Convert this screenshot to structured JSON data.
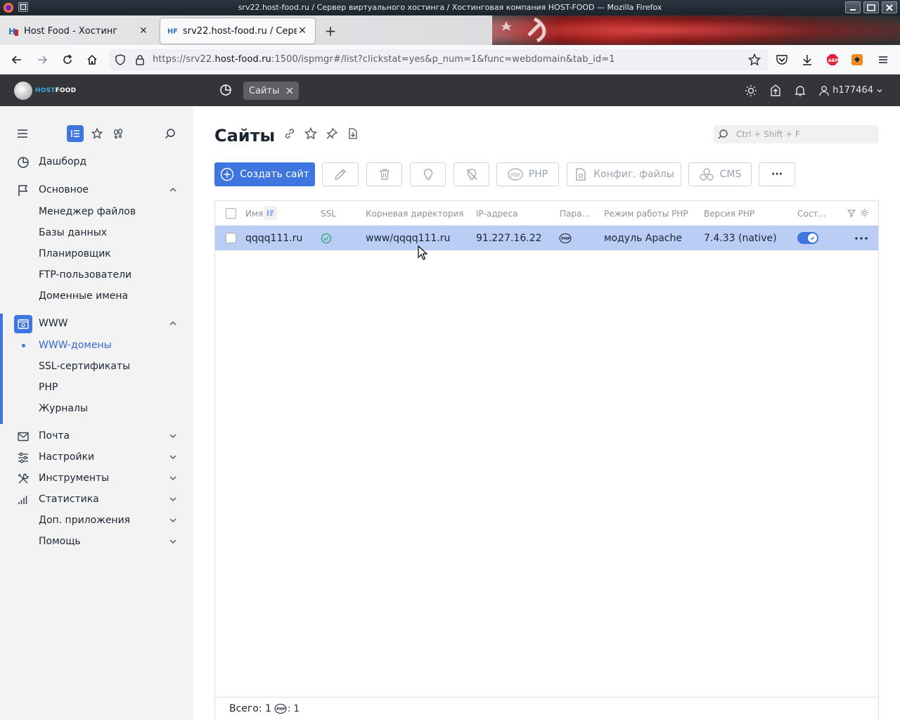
{
  "window": {
    "title": "srv22.host-food.ru / Сервер виртуального хостинга / Хостинговая компания HOST-FOOD — Mozilla Firefox"
  },
  "browser": {
    "tabs": [
      {
        "label": "Host Food - Хостинг",
        "favicon": "hf-red-icon"
      },
      {
        "label": "srv22.host-food.ru / Сервер",
        "favicon": "hf-blue-icon"
      }
    ],
    "url_prefix": "https://srv22.",
    "url_host": "host-food.ru",
    "url_suffix": ":1500/ispmgr#/list?clickstat=yes&p_num=1&func=webdomain&tab_id=1"
  },
  "header": {
    "logo_host": "HOST",
    "logo_food": "FOOD",
    "chip_label": "Сайты",
    "username": "h177464"
  },
  "sidebar": {
    "dashboard": "Дашборд",
    "main": "Основное",
    "main_items": [
      "Менеджер файлов",
      "Базы данных",
      "Планировщик",
      "FTP-пользователи",
      "Доменные имена"
    ],
    "www": "WWW",
    "www_items": [
      "WWW-домены",
      "SSL-сертификаты",
      "PHP",
      "Журналы"
    ],
    "mail": "Почта",
    "settings": "Настройки",
    "tools": "Инструменты",
    "stats": "Статистика",
    "extra_apps": "Доп. приложения",
    "help": "Помощь"
  },
  "page": {
    "title": "Сайты",
    "search_placeholder": "Ctrl + Shift + F"
  },
  "toolbar": {
    "create_site": "Создать сайт",
    "php": "PHP",
    "config_files": "Конфиг. файлы",
    "cms": "CMS",
    "more": "···"
  },
  "table": {
    "columns": [
      "Имя",
      "SSL",
      "Корневая директория",
      "IP-адреса",
      "Пара...",
      "Режим работы PHP",
      "Версия PHP",
      "Сост..."
    ],
    "rows": [
      {
        "name": "qqqq111.ru",
        "ssl": "check-icon",
        "root_dir": "www/qqqq111.ru",
        "ip": "91.227.16.22",
        "params": "php-icon",
        "php_mode": "модуль Apache",
        "php_version": "7.4.33 (native)",
        "status": "on"
      }
    ]
  },
  "footer": {
    "total_label": "Всего: 1",
    "php_count": ": 1"
  },
  "colors": {
    "accent": "#3f75de",
    "header_bg": "#343538",
    "selected_row": "#b9cdf5",
    "sidebar_bg": "#f3f3f4"
  }
}
